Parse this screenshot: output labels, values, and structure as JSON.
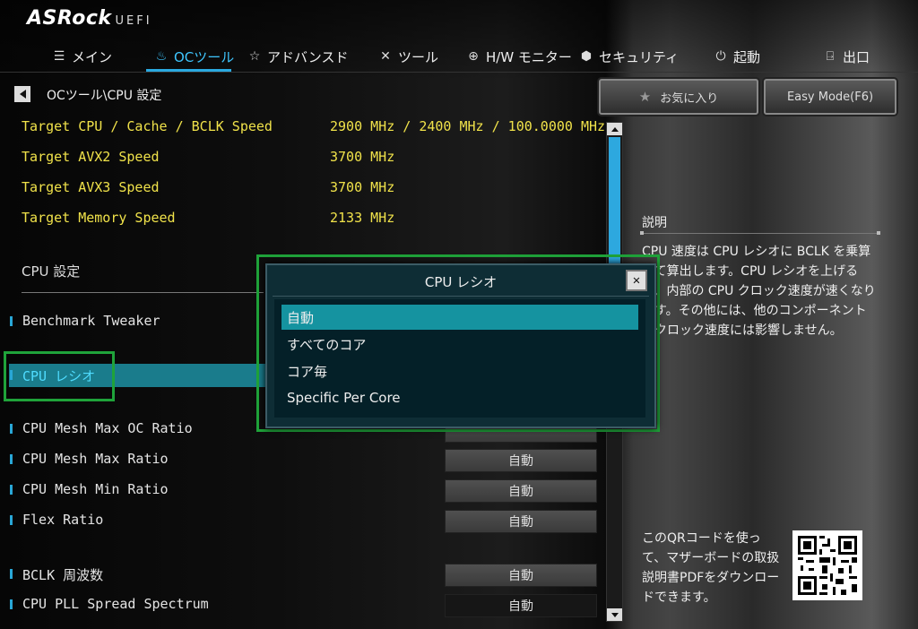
{
  "header": {
    "logo": "ASRock",
    "logo_sub": "UEFI",
    "tabs": [
      {
        "label": "メイン",
        "icon": "list-icon"
      },
      {
        "label": "OCツール",
        "icon": "flame-icon",
        "active": true
      },
      {
        "label": "アドバンスド",
        "icon": "star-icon"
      },
      {
        "label": "ツール",
        "icon": "tools-icon"
      },
      {
        "label": "H/W モニター",
        "icon": "monitor-icon"
      },
      {
        "label": "セキュリティ",
        "icon": "shield-icon"
      },
      {
        "label": "起動",
        "icon": "power-icon"
      },
      {
        "label": "出口",
        "icon": "exit-icon"
      }
    ]
  },
  "breadcrumb": "OCツール\\CPU 設定",
  "buttons": {
    "favorites": "お気に入り",
    "easy_mode": "Easy Mode(F6)"
  },
  "targets": [
    {
      "label": "Target CPU / Cache / BCLK Speed",
      "value": "2900 MHz / 2400 MHz / 100.0000 MHz"
    },
    {
      "label": "Target AVX2 Speed",
      "value": "3700 MHz"
    },
    {
      "label": "Target AVX3 Speed",
      "value": "3700 MHz"
    },
    {
      "label": "Target Memory Speed",
      "value": "2133 MHz"
    }
  ],
  "section_title": "CPU 設定",
  "items": {
    "benchmark": "Benchmark Tweaker",
    "cpu_ratio": "CPU レシオ",
    "mesh_max_oc": "CPU Mesh Max OC Ratio",
    "mesh_max": "CPU Mesh Max Ratio",
    "mesh_min": "CPU Mesh Min Ratio",
    "flex": "Flex Ratio",
    "bclk": "BCLK 周波数",
    "pll": "CPU PLL Spread Spectrum"
  },
  "values": {
    "mesh_max": "自動",
    "mesh_min": "自動",
    "flex": "自動",
    "bclk": "自動",
    "pll": "自動"
  },
  "description": {
    "title": "説明",
    "text": "CPU 速度は CPU レシオに BCLK を乗算して算出します。CPU レシオを上げると、内部の CPU クロック速度が速くなります。その他には、他のコンポーネントのクロック速度には影響しません。",
    "qr_text": "このQRコードを使って、マザーボードの取扱説明書PDFをダウンロードできます。"
  },
  "dialog": {
    "title": "CPU レシオ",
    "close": "✕",
    "options": [
      "自動",
      "すべてのコア",
      "コア毎",
      "Specific Per Core"
    ],
    "selected_index": 0
  },
  "colors": {
    "accent": "#2aa9e0",
    "target_text": "#f0e24a",
    "dialog_bg": "#0e2d35",
    "selection": "#1593a0",
    "highlight": "#1fa33a"
  }
}
